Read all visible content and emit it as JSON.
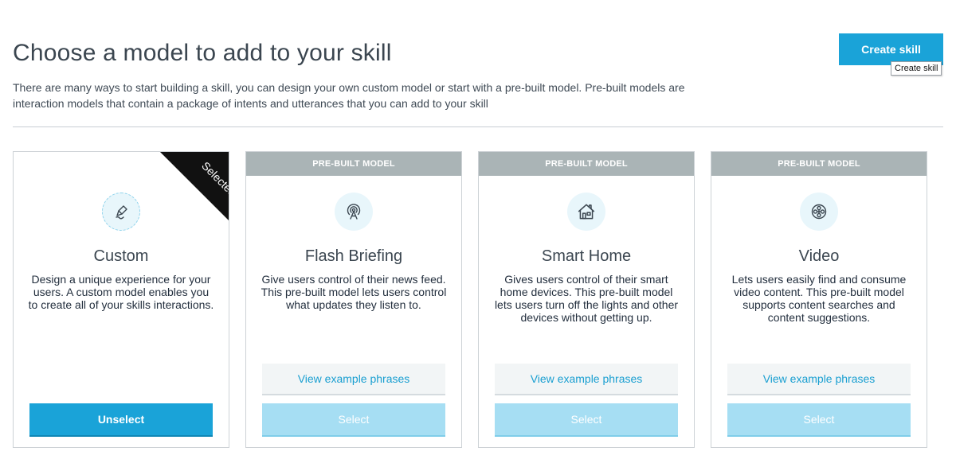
{
  "header": {
    "title": "Choose a model to add to your skill",
    "description": "There are many ways to start building a skill, you can design your own custom model or start with a pre-built model.  Pre-built models are interaction models that contain a package of intents and utterances that you can add to your skill",
    "create_button": "Create skill",
    "create_tooltip": "Create skill"
  },
  "colors": {
    "accent": "#1aa3d8",
    "header_gray": "#aab4b6",
    "select_disabled": "#a6def3",
    "link": "#1a9fd1"
  },
  "cards": [
    {
      "badge": "Selected",
      "icon": "pencil-icon",
      "title": "Custom",
      "description": "Design a unique experience for your users. A custom model enables you to create all of your skills interactions.",
      "primary_button": "Unselect",
      "selected": true
    },
    {
      "header": "PRE-BUILT MODEL",
      "icon": "broadcast-icon",
      "title": "Flash Briefing",
      "description": "Give users control of their news feed. This pre-built model lets users control what updates they listen to.",
      "phrases_button": "View example phrases",
      "primary_button": "Select",
      "selected": false
    },
    {
      "header": "PRE-BUILT MODEL",
      "icon": "house-icon",
      "title": "Smart Home",
      "description": "Gives users control of their smart home devices. This pre-built model lets users turn off the lights and other devices without getting up.",
      "phrases_button": "View example phrases",
      "primary_button": "Select",
      "selected": false
    },
    {
      "header": "PRE-BUILT MODEL",
      "icon": "film-reel-icon",
      "title": "Video",
      "description": "Lets users easily find and consume video content. This pre-built model supports content searches and content suggestions.",
      "phrases_button": "View example phrases",
      "primary_button": "Select",
      "selected": false
    }
  ]
}
